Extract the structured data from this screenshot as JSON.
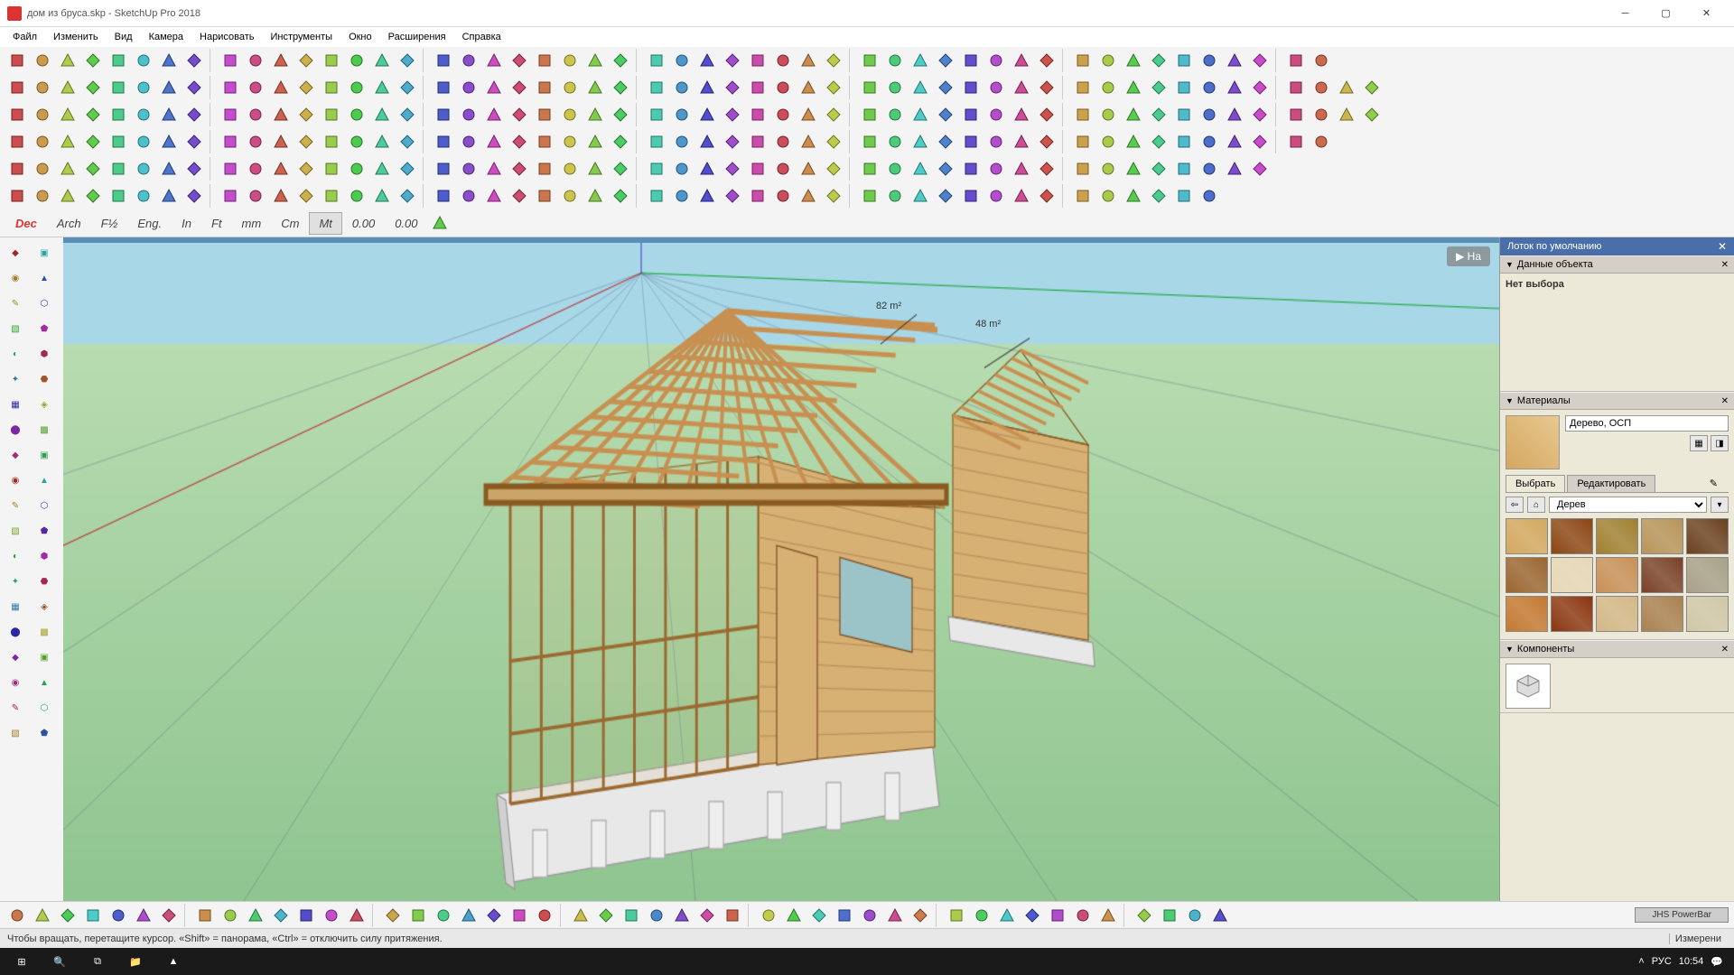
{
  "title": "дом из бруса.skp - SketchUp Pro 2018",
  "menu": [
    "Файл",
    "Изменить",
    "Вид",
    "Камера",
    "Нарисовать",
    "Инструменты",
    "Окно",
    "Расширения",
    "Справка"
  ],
  "units": [
    {
      "label": "Dec",
      "cls": "dec"
    },
    {
      "label": "Arch"
    },
    {
      "label": "F½"
    },
    {
      "label": "Eng."
    },
    {
      "label": "In"
    },
    {
      "label": "Ft"
    },
    {
      "label": "mm"
    },
    {
      "label": "Cm"
    },
    {
      "label": "Mt",
      "active": true
    },
    {
      "label": "0.00"
    },
    {
      "label": "0.00"
    }
  ],
  "tray": {
    "title": "Лоток по умолчанию",
    "entity": {
      "title": "Данные объекта",
      "nosel": "Нет выбора"
    },
    "materials": {
      "title": "Материалы",
      "name": "Дерево, ОСП",
      "tab_select": "Выбрать",
      "tab_edit": "Редактировать",
      "category": "Дерев",
      "swatches": [
        "#d4a860",
        "#8b4513",
        "#a08030",
        "#b8945a",
        "#6b4020",
        "#9b6530",
        "#e8d8b8",
        "#c89058",
        "#7a4028",
        "#a8a088",
        "#c47830",
        "#8b3510",
        "#d4b888",
        "#aa8050",
        "#d0c8a8"
      ]
    },
    "components": {
      "title": "Компоненты"
    }
  },
  "viewport": {
    "label1": "82 m²",
    "label2": "48 m²",
    "right_btn": "На"
  },
  "status": {
    "hint": "Чтобы вращать, перетащите курсор. «Shift» = панорама, «Ctrl» = отключить силу притяжения.",
    "measure": "Измерени"
  },
  "powerbar": "JHS PowerBar",
  "taskbar": {
    "lang": "РУС",
    "time": "10:54"
  }
}
